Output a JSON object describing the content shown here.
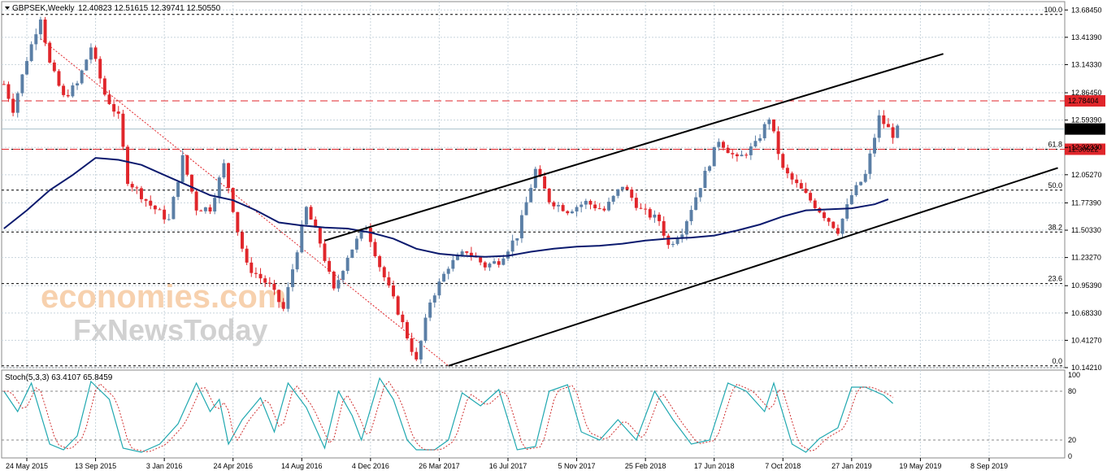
{
  "header": {
    "symbol": "GBPSEK,Weekly",
    "ohlc": "12.40823 12.51615 12.39741 12.50550"
  },
  "indicator": {
    "label": "Stoch(5,3,3) 63.4107 65.8459",
    "levels": [
      "100",
      "80",
      "20",
      "0"
    ]
  },
  "watermark": {
    "line1": "economies.com",
    "line2": "FxNewsToday"
  },
  "colors": {
    "bull": "#5b7fa6",
    "bear": "#e0262b",
    "ma": "#0b1a6e",
    "stoch_main": "#20a8b0",
    "stoch_signal": "#d03030",
    "grid": "#c8d4dc",
    "price_label_bg": "#e0262b"
  },
  "chart_data": {
    "type": "line",
    "y_ticks": [
      "13.68450",
      "13.41390",
      "13.14330",
      "12.86450",
      "12.59390",
      "12.32330",
      "12.05270",
      "11.77390",
      "11.50330",
      "11.23270",
      "10.95390",
      "10.68330",
      "10.41270",
      "10.14210"
    ],
    "x_ticks": [
      "24 May 2015",
      "13 Sep 2015",
      "3 Jan 2016",
      "24 Apr 2016",
      "14 Aug 2016",
      "4 Dec 2016",
      "26 Mar 2017",
      "16 Jul 2017",
      "5 Nov 2017",
      "25 Feb 2018",
      "17 Jun 2018",
      "7 Oct 2018",
      "27 Jan 2019",
      "19 May 2019",
      "8 Sep 2019"
    ],
    "ylim": [
      10.1421,
      13.7671
    ],
    "fibonacci": [
      {
        "label": "100.0",
        "value": 13.64
      },
      {
        "label": "61.8",
        "value": 12.3052
      },
      {
        "label": "50.0",
        "value": 11.9
      },
      {
        "label": "38.2",
        "value": 11.485
      },
      {
        "label": "23.6",
        "value": 10.975
      },
      {
        "label": "0.0",
        "value": 10.16
      }
    ],
    "price_lines": [
      {
        "label": "12.78404",
        "value": 12.78404
      },
      {
        "label": "12.30522",
        "value": 12.30522
      }
    ],
    "current_price": {
      "label": "12.50550",
      "value": 12.5055
    },
    "anchors": [
      [
        0,
        12.95
      ],
      [
        2,
        12.7
      ],
      [
        5,
        13.2
      ],
      [
        8,
        13.62
      ],
      [
        10,
        13.15
      ],
      [
        13,
        12.82
      ],
      [
        16,
        12.95
      ],
      [
        19,
        13.32
      ],
      [
        22,
        12.85
      ],
      [
        25,
        12.62
      ],
      [
        27,
        12.0
      ],
      [
        32,
        11.75
      ],
      [
        36,
        11.6
      ],
      [
        39,
        12.22
      ],
      [
        42,
        11.72
      ],
      [
        45,
        11.72
      ],
      [
        48,
        12.15
      ],
      [
        51,
        11.5
      ],
      [
        53,
        11.15
      ],
      [
        58,
        10.95
      ],
      [
        61,
        10.72
      ],
      [
        66,
        11.72
      ],
      [
        69,
        11.38
      ],
      [
        72,
        10.9
      ],
      [
        75,
        11.25
      ],
      [
        79,
        11.55
      ],
      [
        82,
        11.15
      ],
      [
        86,
        10.7
      ],
      [
        90,
        10.2
      ],
      [
        93,
        10.8
      ],
      [
        97,
        11.15
      ],
      [
        101,
        11.3
      ],
      [
        105,
        11.15
      ],
      [
        108,
        11.2
      ],
      [
        112,
        11.45
      ],
      [
        116,
        12.1
      ],
      [
        119,
        11.8
      ],
      [
        123,
        11.7
      ],
      [
        127,
        11.78
      ],
      [
        131,
        11.7
      ],
      [
        135,
        11.95
      ],
      [
        139,
        11.7
      ],
      [
        143,
        11.6
      ],
      [
        145,
        11.35
      ],
      [
        148,
        11.5
      ],
      [
        152,
        11.95
      ],
      [
        156,
        12.4
      ],
      [
        160,
        12.2
      ],
      [
        164,
        12.35
      ],
      [
        167,
        12.62
      ],
      [
        170,
        12.1
      ],
      [
        173,
        11.95
      ],
      [
        177,
        11.75
      ],
      [
        180,
        11.6
      ],
      [
        182,
        11.5
      ],
      [
        185,
        11.85
      ],
      [
        188,
        12.05
      ],
      [
        191,
        12.62
      ],
      [
        194,
        12.45
      ],
      [
        195,
        12.5
      ]
    ],
    "ma": [
      [
        0,
        11.52
      ],
      [
        5,
        11.7
      ],
      [
        10,
        11.9
      ],
      [
        15,
        12.05
      ],
      [
        20,
        12.22
      ],
      [
        25,
        12.2
      ],
      [
        30,
        12.15
      ],
      [
        35,
        12.05
      ],
      [
        40,
        11.95
      ],
      [
        45,
        11.85
      ],
      [
        50,
        11.8
      ],
      [
        55,
        11.7
      ],
      [
        60,
        11.58
      ],
      [
        65,
        11.55
      ],
      [
        70,
        11.53
      ],
      [
        75,
        11.52
      ],
      [
        80,
        11.48
      ],
      [
        85,
        11.42
      ],
      [
        90,
        11.32
      ],
      [
        95,
        11.27
      ],
      [
        100,
        11.25
      ],
      [
        105,
        11.24
      ],
      [
        110,
        11.25
      ],
      [
        115,
        11.29
      ],
      [
        120,
        11.32
      ],
      [
        125,
        11.34
      ],
      [
        130,
        11.35
      ],
      [
        135,
        11.37
      ],
      [
        140,
        11.4
      ],
      [
        145,
        11.42
      ],
      [
        150,
        11.43
      ],
      [
        155,
        11.45
      ],
      [
        160,
        11.5
      ],
      [
        165,
        11.56
      ],
      [
        170,
        11.64
      ],
      [
        175,
        11.7
      ],
      [
        180,
        11.71
      ],
      [
        185,
        11.72
      ],
      [
        190,
        11.76
      ],
      [
        193,
        11.81
      ]
    ],
    "trendlines": [
      {
        "from": [
          70,
          11.4
        ],
        "to": [
          205,
          13.25
        ]
      },
      {
        "from": [
          97,
          10.16
        ],
        "to": [
          230,
          12.12
        ]
      }
    ],
    "stoch_anchors": [
      [
        0,
        80
      ],
      [
        3,
        55
      ],
      [
        6,
        90
      ],
      [
        10,
        15
      ],
      [
        13,
        8
      ],
      [
        16,
        25
      ],
      [
        19,
        92
      ],
      [
        23,
        70
      ],
      [
        26,
        10
      ],
      [
        30,
        5
      ],
      [
        34,
        15
      ],
      [
        38,
        40
      ],
      [
        42,
        90
      ],
      [
        45,
        55
      ],
      [
        47,
        70
      ],
      [
        49,
        15
      ],
      [
        52,
        45
      ],
      [
        56,
        72
      ],
      [
        59,
        30
      ],
      [
        62,
        90
      ],
      [
        66,
        60
      ],
      [
        70,
        10
      ],
      [
        73,
        80
      ],
      [
        76,
        50
      ],
      [
        78,
        20
      ],
      [
        82,
        96
      ],
      [
        85,
        70
      ],
      [
        88,
        20
      ],
      [
        90,
        8
      ],
      [
        94,
        8
      ],
      [
        97,
        20
      ],
      [
        100,
        78
      ],
      [
        104,
        62
      ],
      [
        108,
        82
      ],
      [
        112,
        8
      ],
      [
        116,
        12
      ],
      [
        119,
        80
      ],
      [
        123,
        88
      ],
      [
        126,
        30
      ],
      [
        130,
        20
      ],
      [
        134,
        45
      ],
      [
        138,
        20
      ],
      [
        142,
        80
      ],
      [
        146,
        45
      ],
      [
        150,
        15
      ],
      [
        154,
        20
      ],
      [
        158,
        90
      ],
      [
        162,
        80
      ],
      [
        166,
        55
      ],
      [
        168,
        90
      ],
      [
        172,
        15
      ],
      [
        175,
        5
      ],
      [
        178,
        22
      ],
      [
        182,
        35
      ],
      [
        185,
        85
      ],
      [
        188,
        85
      ],
      [
        192,
        75
      ],
      [
        194,
        65
      ]
    ]
  }
}
